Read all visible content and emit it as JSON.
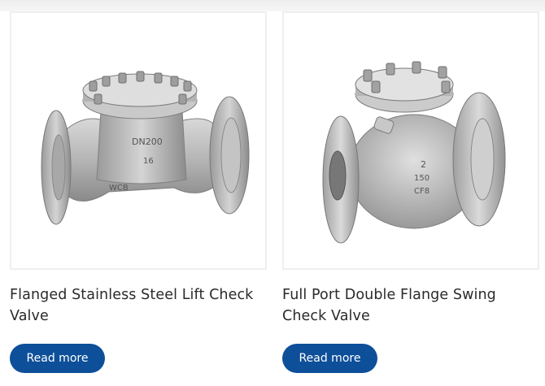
{
  "products": [
    {
      "title": "Flanged Stainless Steel Lift Check Valve",
      "button_label": "Read more",
      "image_markings": [
        "DN200",
        "16",
        "WCB"
      ]
    },
    {
      "title": "Full Port Double Flange Swing Check Valve",
      "button_label": "Read more",
      "image_markings": [
        "2",
        "150",
        "CF8"
      ]
    }
  ],
  "colors": {
    "button_bg": "#0d4f99",
    "button_text": "#ffffff",
    "title_text": "#2a2a2a",
    "card_border": "#efefef"
  }
}
